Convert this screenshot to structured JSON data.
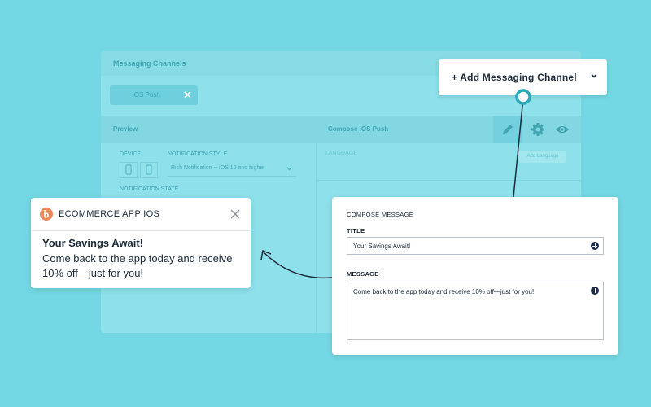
{
  "background_color": "#74d8e4",
  "messaging_panel": {
    "title": "Messaging Channels",
    "channel_chip": "iOS Push",
    "preview_label": "Preview",
    "compose_label": "Compose iOS Push",
    "device_label": "DEVICE",
    "notification_style_label": "NOTIFICATION STYLE",
    "notification_style_value": "Rich Notification -- iOS 10 and higher",
    "notification_state_label": "NOTIFICATION STATE",
    "language_label": "LANGUAGE",
    "add_language_label": "Add Language",
    "toolbar_icons": [
      "pencil-icon",
      "gear-icon",
      "eye-icon"
    ]
  },
  "add_channel": {
    "label": "+ Add Messaging Channel",
    "icon": "chevron-down-icon"
  },
  "notification_preview": {
    "app_name": "ECOMMERCE APP IOS",
    "title": "Your Savings Await!",
    "body": "Come back to the app today and receive 10% off—just for you!",
    "accent_color": "#f08a5d"
  },
  "compose_message": {
    "heading": "COMPOSE MESSAGE",
    "title_label": "TITLE",
    "title_value": "Your Savings Await!",
    "message_label": "MESSAGE",
    "message_value": "Come back to the app today and receive 10% off—just for you!",
    "accent_color": "#1e2b4a"
  }
}
